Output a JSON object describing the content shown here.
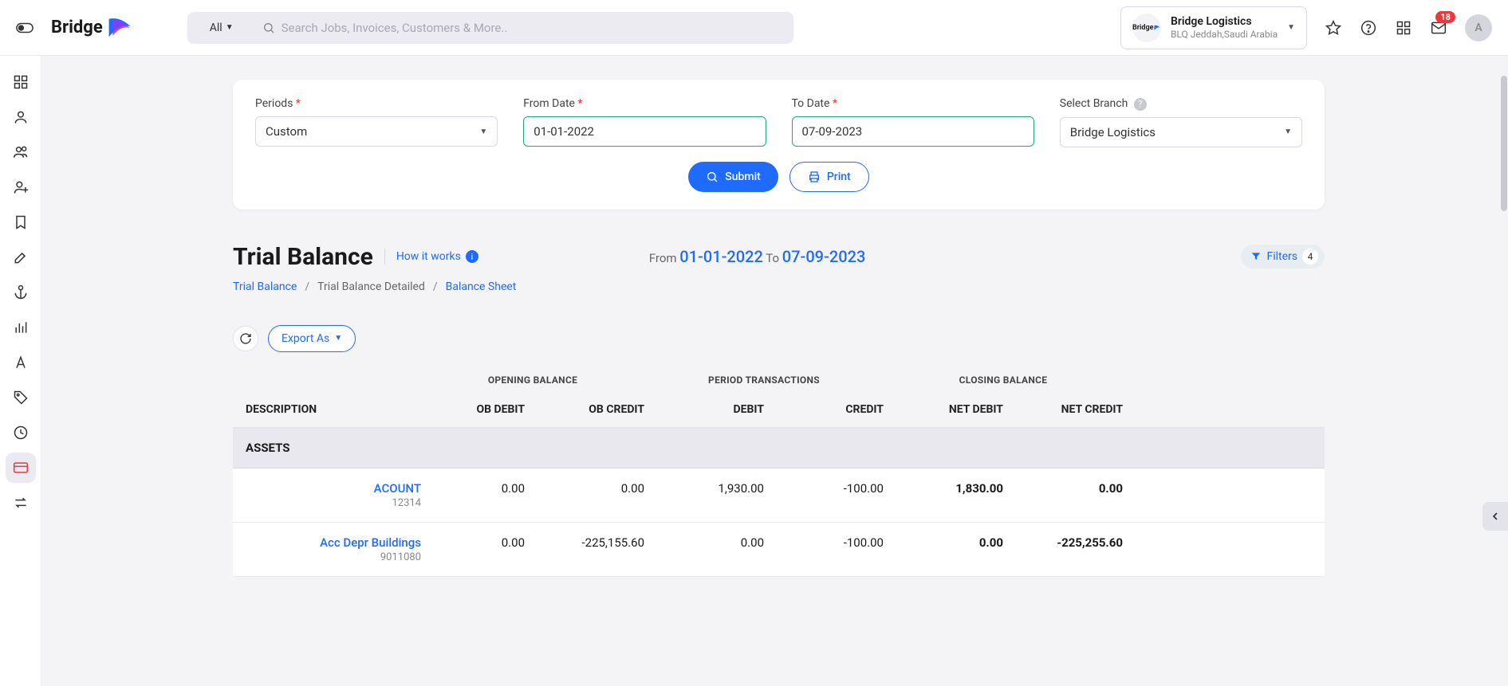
{
  "search": {
    "filter": "All",
    "placeholder": "Search Jobs, Invoices, Customers & More.."
  },
  "company": {
    "name": "Bridge Logistics",
    "location": "BLQ Jeddah,Saudi Arabia",
    "mini": "Bridge"
  },
  "notifications": {
    "mail_count": "18"
  },
  "avatar_initial": "A",
  "filter_form": {
    "periods_label": "Periods",
    "periods_value": "Custom",
    "from_label": "From Date",
    "from_value": "01-01-2022",
    "to_label": "To Date",
    "to_value": "07-09-2023",
    "branch_label": "Select Branch",
    "branch_value": "Bridge Logistics",
    "submit": "Submit",
    "print": "Print"
  },
  "page": {
    "title": "Trial Balance",
    "how_link": "How it works",
    "range_from_label": "From",
    "range_from": "01-01-2022",
    "range_to_label": "To",
    "range_to": "07-09-2023"
  },
  "filters_pill": {
    "label": "Filters",
    "count": "4"
  },
  "breadcrumb": {
    "a": "Trial Balance",
    "b": "Trial Balance Detailed",
    "c": "Balance Sheet"
  },
  "export_label": "Export As",
  "table": {
    "group_opening": "OPENING BALANCE",
    "group_period": "PERIOD TRANSACTIONS",
    "group_closing": "CLOSING BALANCE",
    "col_desc": "DESCRIPTION",
    "col_obd": "OB DEBIT",
    "col_obc": "OB CREDIT",
    "col_d": "DEBIT",
    "col_c": "CREDIT",
    "col_nd": "NET DEBIT",
    "col_nc": "NET CREDIT",
    "section": "ASSETS",
    "rows": [
      {
        "name": "ACOUNT",
        "code": "12314",
        "obd": "0.00",
        "obc": "0.00",
        "d": "1,930.00",
        "c": "-100.00",
        "nd": "1,830.00",
        "nc": "0.00"
      },
      {
        "name": "Acc Depr Buildings",
        "code": "9011080",
        "obd": "0.00",
        "obc": "-225,155.60",
        "d": "0.00",
        "c": "-100.00",
        "nd": "0.00",
        "nc": "-225,255.60"
      }
    ]
  }
}
